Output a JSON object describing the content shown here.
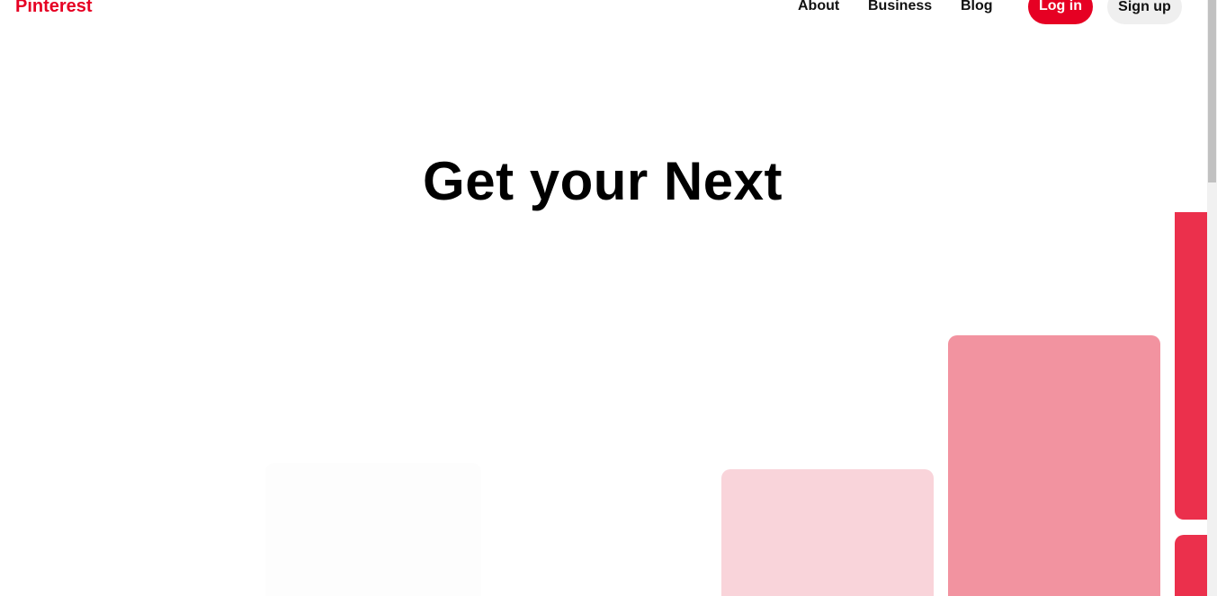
{
  "header": {
    "logo_text": "Pinterest",
    "nav": {
      "about": "About",
      "business": "Business",
      "blog": "Blog"
    },
    "login_label": "Log in",
    "signup_label": "Sign up"
  },
  "hero": {
    "headline": "Get your Next"
  },
  "colors": {
    "brand": "#e60023",
    "card_light": "#f9d4da",
    "card_mid": "#f293a0",
    "card_strong": "#eb304c"
  }
}
